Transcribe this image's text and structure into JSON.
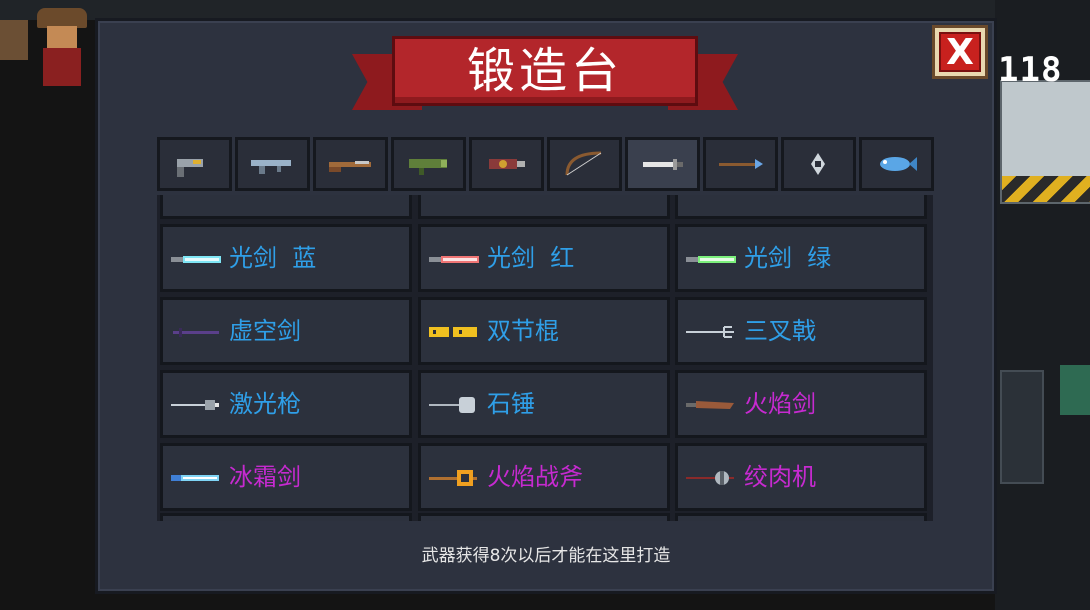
{
  "title": "锻造台",
  "close_label": "X",
  "coin_count": "118",
  "footer_note": "武器获得8次以后才能在这里打造",
  "colors": {
    "blue": "#2f9fe8",
    "purple": "#c62ad0"
  },
  "tabs": [
    {
      "icon": "pistol-icon"
    },
    {
      "icon": "rifle-icon"
    },
    {
      "icon": "shotgun-icon"
    },
    {
      "icon": "rocket-launcher-icon"
    },
    {
      "icon": "blaster-icon"
    },
    {
      "icon": "bow-icon"
    },
    {
      "icon": "sword-icon",
      "selected": true
    },
    {
      "icon": "spear-icon"
    },
    {
      "icon": "shuriken-icon"
    },
    {
      "icon": "fish-icon"
    }
  ],
  "weapons": [
    {
      "name": "光剑  蓝",
      "rarity": "blue",
      "icon": "lightsaber-blue-icon",
      "accent": "#7fe6f5"
    },
    {
      "name": "光剑  红",
      "rarity": "blue",
      "icon": "lightsaber-red-icon",
      "accent": "#f07575"
    },
    {
      "name": "光剑  绿",
      "rarity": "blue",
      "icon": "lightsaber-green-icon",
      "accent": "#7cf07c"
    },
    {
      "name": "虚空剑",
      "rarity": "blue",
      "icon": "void-sword-icon",
      "accent": "#5a3f8a"
    },
    {
      "name": "双节棍",
      "rarity": "blue",
      "icon": "nunchaku-icon",
      "accent": "#f0c020"
    },
    {
      "name": "三叉戟",
      "rarity": "blue",
      "icon": "trident-icon",
      "accent": "#c8d0d8"
    },
    {
      "name": "激光枪",
      "rarity": "blue",
      "icon": "laser-gun-icon",
      "accent": "#c8d0d8"
    },
    {
      "name": "石锤",
      "rarity": "blue",
      "icon": "stone-hammer-icon",
      "accent": "#c8d0d8"
    },
    {
      "name": "火焰剑",
      "rarity": "purple",
      "icon": "flame-sword-icon",
      "accent": "#9a5a3a"
    },
    {
      "name": "冰霜剑",
      "rarity": "purple",
      "icon": "frost-sword-icon",
      "accent": "#7fd4f5"
    },
    {
      "name": "火焰战斧",
      "rarity": "purple",
      "icon": "flame-axe-icon",
      "accent": "#f0a020"
    },
    {
      "name": "绞肉机",
      "rarity": "purple",
      "icon": "meat-grinder-icon",
      "accent": "#b0b8c0"
    }
  ]
}
